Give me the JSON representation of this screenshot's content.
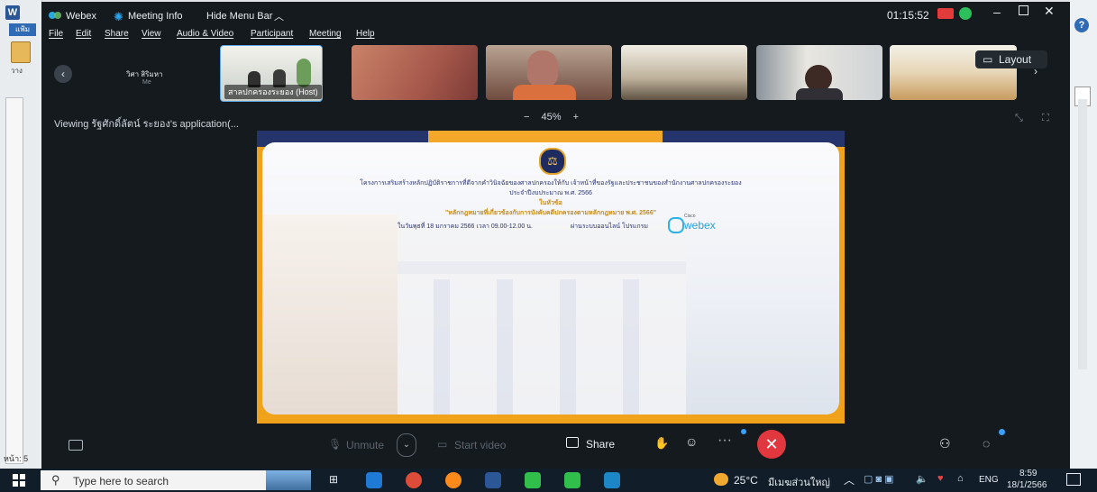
{
  "word": {
    "app_letter": "W",
    "ribbon_tab": "แฟ้ม",
    "paste_label": "วาง",
    "page_indicator": "หน้า: 5"
  },
  "webex": {
    "app_name": "Webex",
    "meeting_info": "Meeting Info",
    "hide_menu_bar": "Hide Menu Bar",
    "timer": "01:15:52",
    "menu": [
      "File",
      "Edit",
      "Share",
      "View",
      "Audio & Video",
      "Participant",
      "Meeting",
      "Help"
    ],
    "self_name": "วิศา สิริมหา",
    "self_sub": "Me",
    "host_label": "สาลปกครองระยอง (Host)",
    "layout_label": "Layout",
    "viewing_text": "Viewing รัฐศักดิ์ลัตน์ ระยอง's application(...",
    "zoom_minus": "−",
    "zoom_level": "45%",
    "zoom_plus": "+",
    "share_label": "Share",
    "unmute_label": "Unmute",
    "start_video_label": "Start video"
  },
  "slide": {
    "line1": "โครงการเสริมสร้างหลักปฏิบัติราชการที่ดีจากคำวินิจฉัยของศาลปกครองให้กับ เจ้าหน้าที่ของรัฐและประชาชนของสำนักงานศาลปกครองระยอง",
    "line2": "ประจำปีงบประมาณ พ.ศ. 2566",
    "line3": "ในหัวข้อ",
    "line4": "\"หลักกฎหมายที่เกี่ยวข้องกับการบังคับคดีปกครองตามหลักกฎหมาย พ.ศ. 2566\"",
    "line5": "ในวันพุธที่ 18 มกราคม 2566 เวลา 09.00-12.00 น.",
    "line6": "ผ่านระบบออนไลน์ โปรแกรม",
    "cisco": "Cisco",
    "webex_logo": "webex"
  },
  "taskbar": {
    "search_placeholder": "Type here to search",
    "weather": "25°C",
    "weather_desc": "มีเมฆส่วนใหญ่",
    "lang": "ENG",
    "time": "8:59",
    "date": "18/1/2566"
  },
  "colors": {
    "webex_bg": "#151a1f",
    "slide_navy": "#25346b",
    "slide_orange": "#f0a21a",
    "leave_red": "#e0383e",
    "taskbar": "#121d2a"
  }
}
